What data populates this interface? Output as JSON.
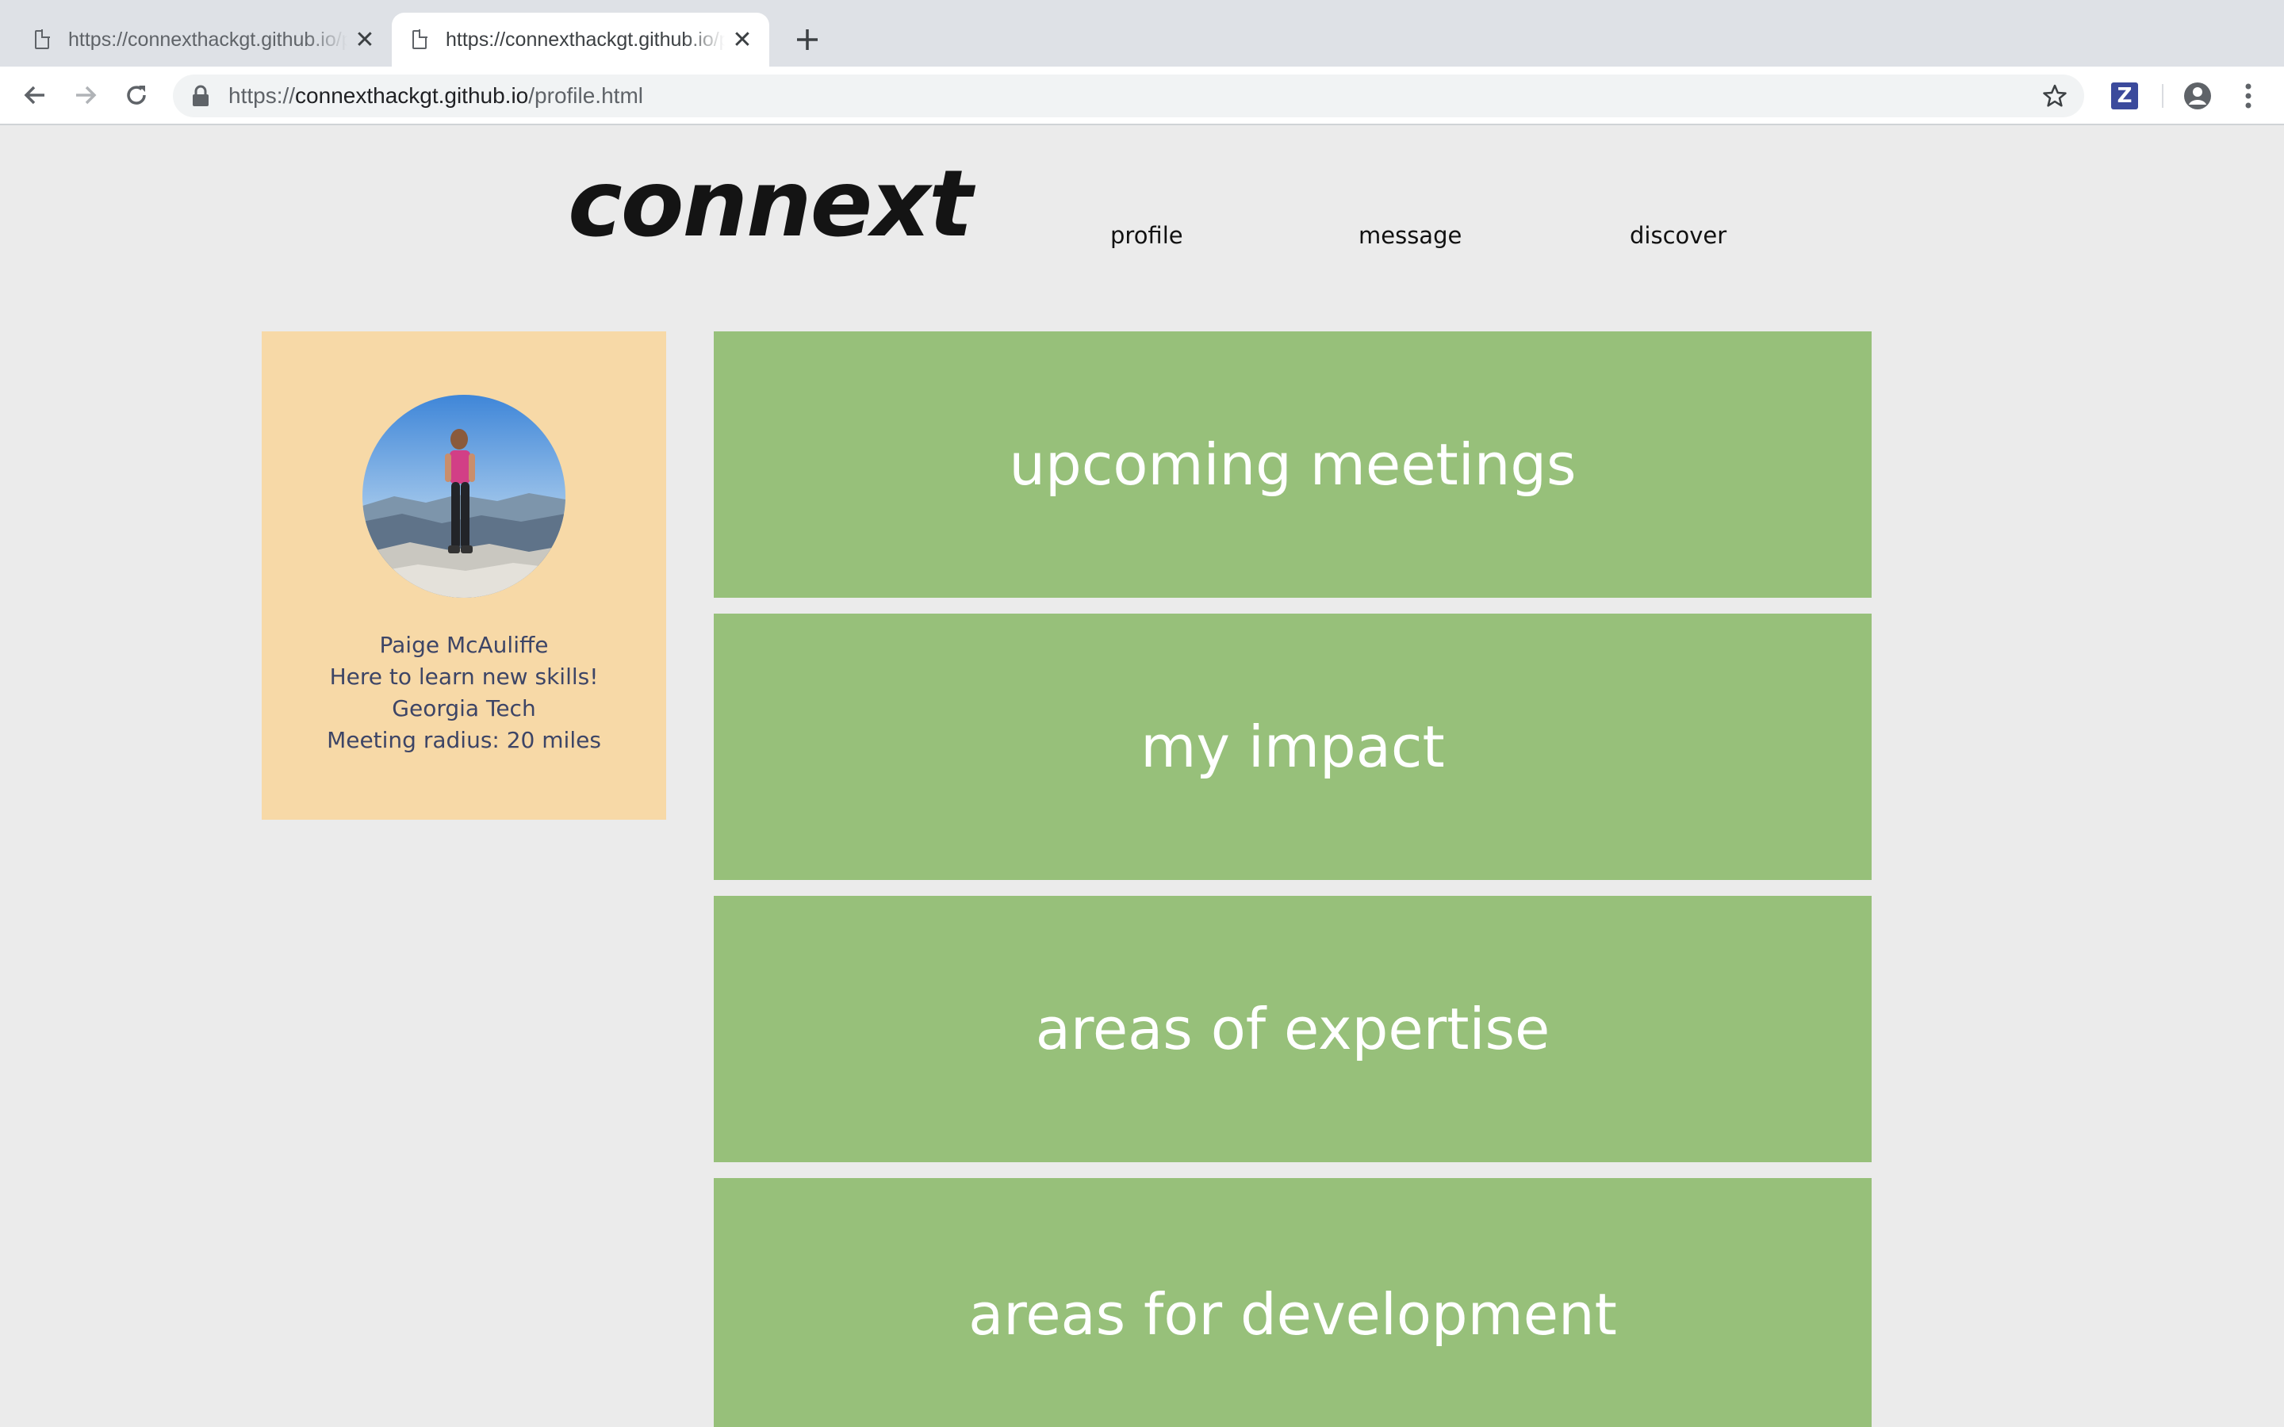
{
  "browser": {
    "tabs": [
      {
        "title": "https://connexthackgt.github.io/profile.html",
        "active": false
      },
      {
        "title": "https://connexthackgt.github.io/profile.html",
        "active": true
      }
    ],
    "new_tab_icon": "plus-icon",
    "url": {
      "scheme": "https://",
      "host": "connexthackgt.github.io",
      "path": "/profile.html"
    },
    "extension_label": "Z"
  },
  "site": {
    "logo": "connext",
    "nav": {
      "profile": "profile",
      "message": "message",
      "discover": "discover"
    }
  },
  "profile": {
    "name": "Paige McAuliffe",
    "tagline": "Here to learn new skills!",
    "school": "Georgia Tech",
    "radius": "Meeting radius: 20 miles"
  },
  "panels": {
    "upcoming": "upcoming meetings",
    "impact": "my impact",
    "expertise": "areas of expertise",
    "development": "areas for development"
  },
  "colors": {
    "card_background": "#f7d9a7",
    "panel_green": "#97c07a",
    "page_background": "#ebebeb"
  }
}
